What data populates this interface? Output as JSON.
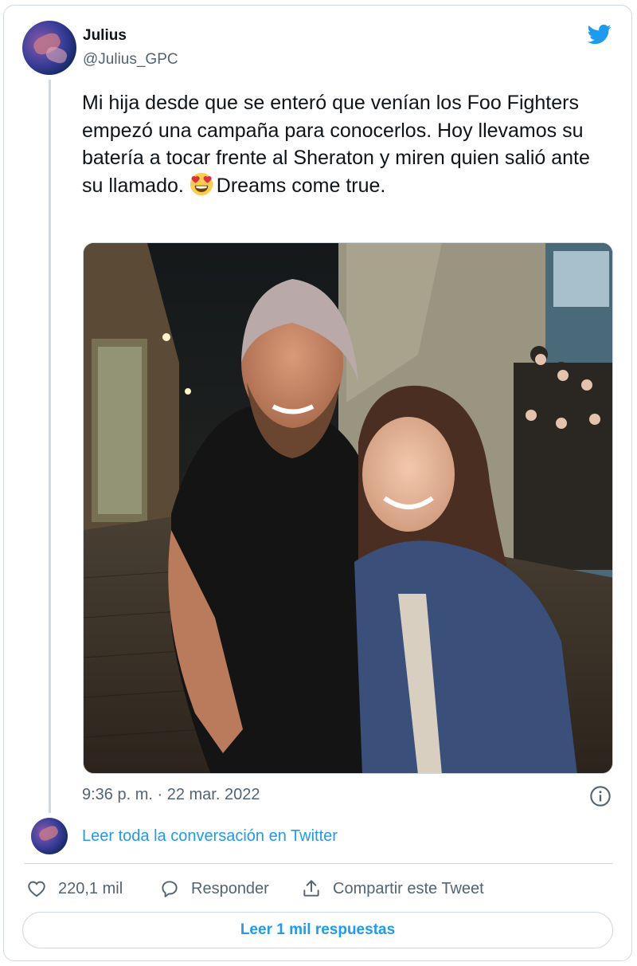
{
  "author": {
    "name": "Julius",
    "handle": "@Julius_GPC"
  },
  "tweet": {
    "text_before_emoji": "Mi hija desde que se enteró que venían los Foo Fighters empezó una campaña para conocerlos. Hoy llevamos su batería a tocar frente al Sheraton y miren quien salió ante su llamado. ",
    "emoji": "smiling-face-with-heart-eyes",
    "text_after_emoji": "Dreams come true.",
    "timestamp": "9:36 p. m. · 22 mar. 2022"
  },
  "conversation": {
    "read_full_label": "Leer toda la conversación en Twitter"
  },
  "actions": {
    "like_count": "220,1 mil",
    "reply_label": "Responder",
    "share_label": "Compartir este Tweet"
  },
  "replies_button": "Leer 1 mil respuestas",
  "colors": {
    "accent": "#1d9bf0",
    "text": "#0f1419",
    "secondary": "#536471",
    "border": "#cfd9de"
  }
}
